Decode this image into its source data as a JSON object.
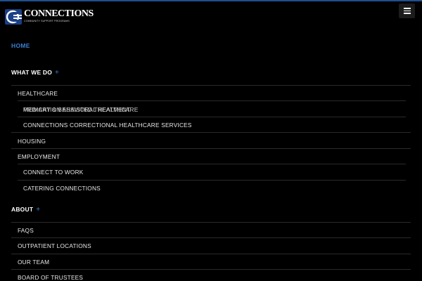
{
  "logo": {
    "name": "CONNECTIONS",
    "tagline": "COMMUNITY SUPPORT PROGRAMS"
  },
  "menu": {
    "home": "HOME",
    "what_we_do": {
      "label": "WHAT WE DO",
      "toggle": "+",
      "healthcare": "HEALTHCARE",
      "healthcare_sub_a": "PRIMARY & BEHAVIORAL HEALTHCARE",
      "healthcare_sub_b": "MEDICATION ASSISTED TREATMENT",
      "healthcare_sub_c": "CONNECTIONS CORRECTIONAL HEALTHCARE SERVICES",
      "housing": "HOUSING",
      "employment": "EMPLOYMENT",
      "employment_sub_a": "CONNECT TO WORK",
      "employment_sub_b": "CATERING CONNECTIONS"
    },
    "about": {
      "label": "ABOUT",
      "toggle": "+",
      "faqs": "FAQS",
      "outpatient": "OUTPATIENT LOCATIONS",
      "team": "OUR TEAM",
      "board": "BOARD OF TRUSTEES"
    }
  },
  "colors": {
    "accent": "#3b7fd1",
    "brand": "#1a3f86",
    "background": "#000000"
  }
}
